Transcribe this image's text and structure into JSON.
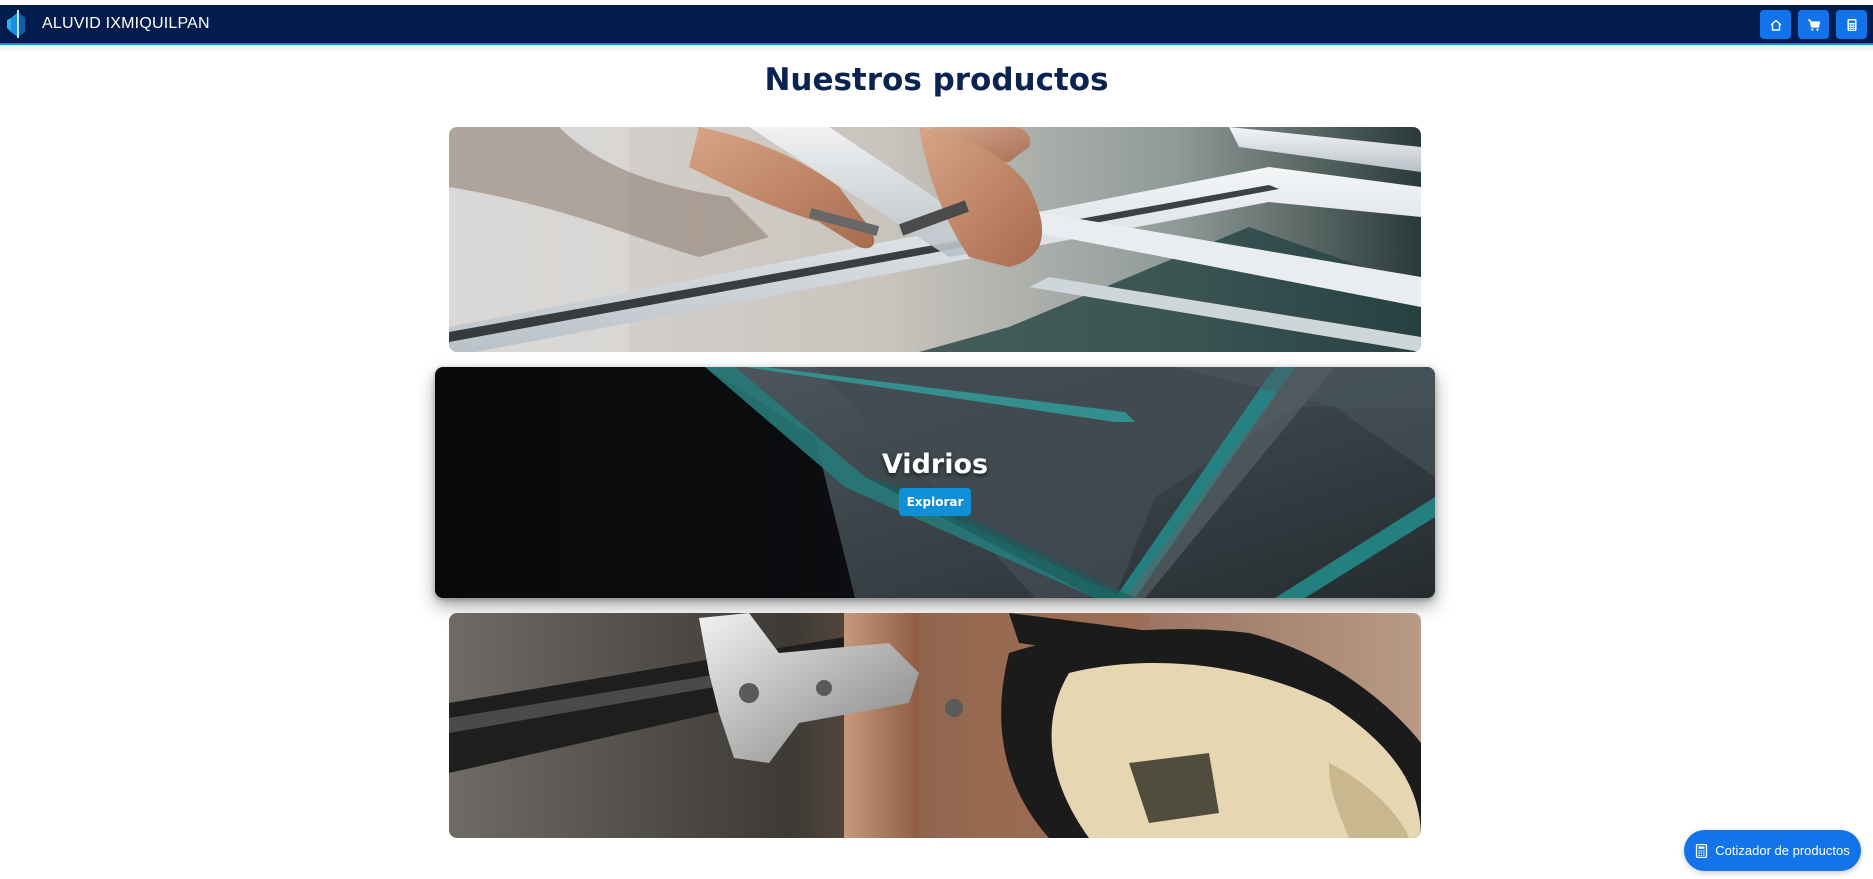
{
  "header": {
    "brand_name": "ALUVID IXMIQUILPAN",
    "logo_icon": "aluvid-logo",
    "actions": [
      {
        "icon": "home-icon",
        "label": "Inicio"
      },
      {
        "icon": "cart-icon",
        "label": "Carrito"
      },
      {
        "icon": "calculator-icon",
        "label": "Cotizador"
      }
    ]
  },
  "main": {
    "title": "Nuestros productos",
    "categories": [
      {
        "image": "aluminum-frame-photo",
        "title": "",
        "button": ""
      },
      {
        "image": "glass-panels-photo",
        "title": "Vidrios",
        "button": "Explorar"
      },
      {
        "image": "cabinet-hinge-photo",
        "title": "",
        "button": ""
      }
    ]
  },
  "floating": {
    "label": "Cotizador de productos",
    "icon": "calculator-icon"
  },
  "colors": {
    "navbar": "#021d4d",
    "accent": "#1273eb",
    "title": "#0b2350",
    "explore_button": "#0f8fd6"
  }
}
